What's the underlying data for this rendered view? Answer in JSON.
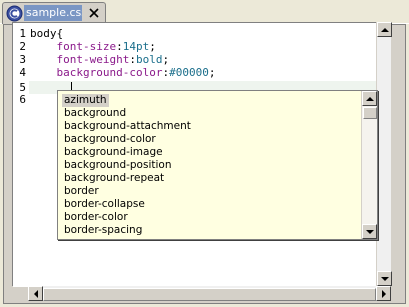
{
  "tab": {
    "label": "sample.css",
    "icon": "css-file-icon",
    "close_icon": "close-icon"
  },
  "editor": {
    "line_numbers": [
      "1",
      "2",
      "3",
      "4",
      "5",
      "6"
    ],
    "lines": [
      {
        "text": "body{"
      },
      {
        "prop": "font-size",
        "sep": ":",
        "value": "14pt",
        "end": ";"
      },
      {
        "prop": "font-weight",
        "sep": ":",
        "value": "bold",
        "end": ";"
      },
      {
        "prop": "background-color",
        "sep": ":",
        "value": "#00000",
        "end": ";"
      },
      {
        "text": ""
      },
      {
        "text": ""
      }
    ]
  },
  "autocomplete": {
    "items": [
      "azimuth",
      "background",
      "background-attachment",
      "background-color",
      "background-image",
      "background-position",
      "background-repeat",
      "border",
      "border-collapse",
      "border-color",
      "border-spacing"
    ],
    "selected_index": 0
  },
  "colors": {
    "property": "#8b1a8b",
    "value": "#1a6e8b",
    "popup_bg": "#ffffe1",
    "tab_highlight": "#7a96c4"
  }
}
